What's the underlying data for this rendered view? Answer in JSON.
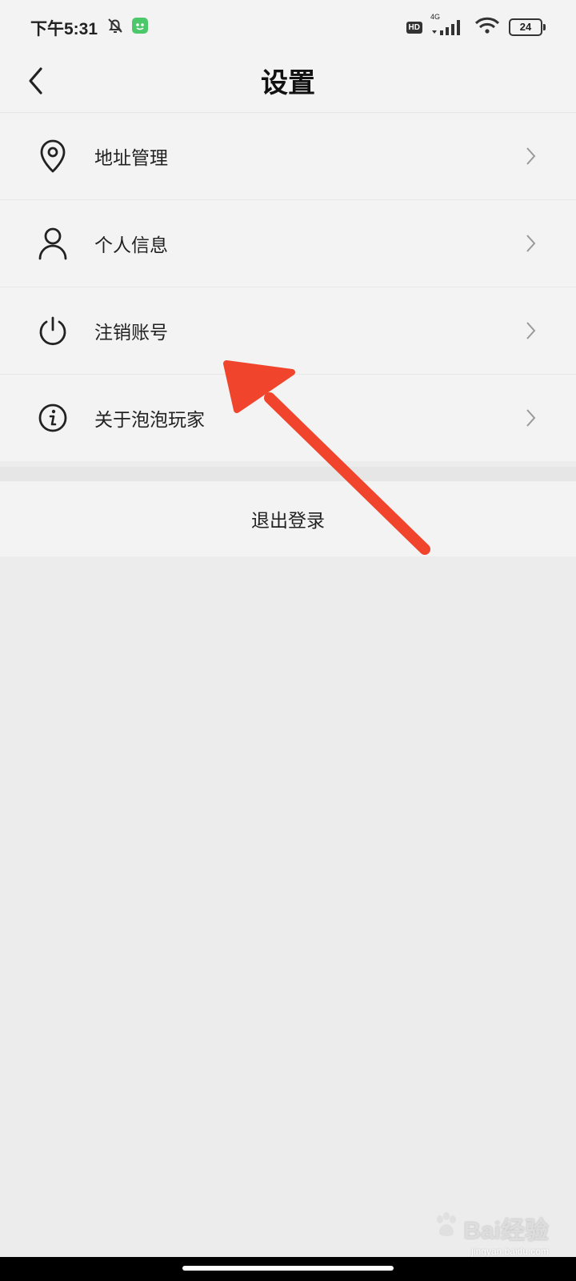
{
  "status_bar": {
    "time": "下午5:31",
    "battery": "24",
    "network": "4G",
    "hd": "HD",
    "icons": [
      "bell-off-icon",
      "app-notification-icon",
      "signal-icon",
      "wifi-icon",
      "battery-icon"
    ]
  },
  "header": {
    "title": "设置",
    "back_icon": "chevron-left-icon"
  },
  "menu": {
    "items": [
      {
        "label": "地址管理",
        "icon": "location-pin-icon"
      },
      {
        "label": "个人信息",
        "icon": "person-icon"
      },
      {
        "label": "注销账号",
        "icon": "power-icon"
      },
      {
        "label": "关于泡泡玩家",
        "icon": "info-icon"
      }
    ]
  },
  "logout": {
    "label": "退出登录"
  },
  "annotation": {
    "color": "#f0442c"
  },
  "watermark": {
    "logo": "Bai经验",
    "site": "jingyan.baidu.com"
  },
  "colors": {
    "accent": "#f0442c",
    "background": "#ececec",
    "surface": "#f3f3f3",
    "app_badge": "#4cc76a"
  }
}
